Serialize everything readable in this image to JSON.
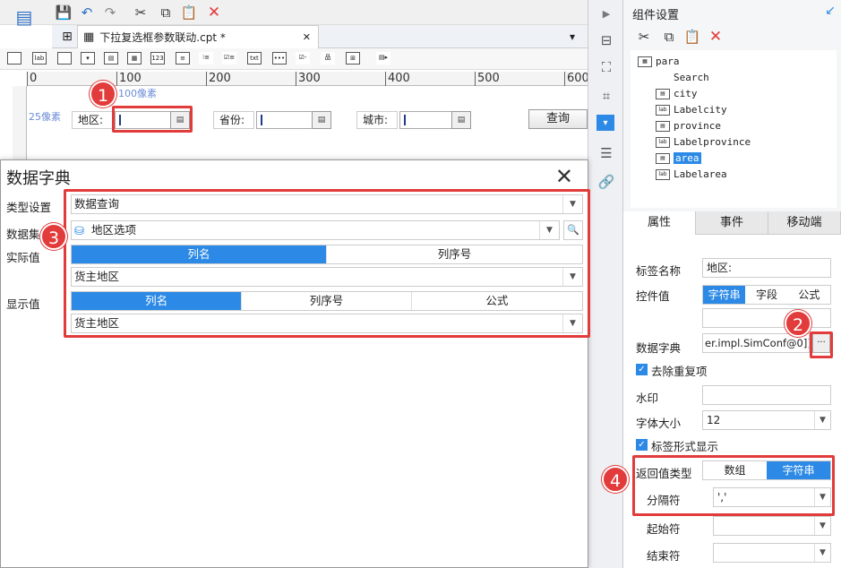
{
  "app": {
    "doc_tab_title": "下拉复选框参数联动.cpt *",
    "doc_tab_close": "✕"
  },
  "ruler": {
    "ticks": [
      "0",
      "100",
      "200",
      "300",
      "400",
      "500",
      "600"
    ],
    "hint_top": "100像素",
    "hint_left": "25像素"
  },
  "form": {
    "area_label": "地区:",
    "province_label": "省份:",
    "city_label": "城市:",
    "query_button": "查询"
  },
  "panel": {
    "title": "组件设置",
    "tree": [
      "para",
      "Search",
      "city",
      "Labelcity",
      "province",
      "Labelprovince",
      "area",
      "Labelarea"
    ],
    "tree_selected": "area",
    "tabs": [
      "属性",
      "事件",
      "移动端"
    ],
    "active_tab": "属性",
    "props": {
      "label_name_label": "标签名称",
      "label_name_value": "地区:",
      "control_value_label": "控件值",
      "control_value_options": [
        "字符串",
        "字段",
        "公式"
      ],
      "control_value_selected": "字符串",
      "dict_label": "数据字典",
      "dict_value": "er.impl.SimConf@0]]",
      "dict_button": "···",
      "dedupe_label": "去除重复项",
      "dedupe_checked": true,
      "watermark_label": "水印",
      "font_size_label": "字体大小",
      "font_size_value": "12",
      "tag_display_label": "标签形式显示",
      "tag_display_checked": true,
      "return_type_label": "返回值类型",
      "return_type_options": [
        "数组",
        "字符串"
      ],
      "return_type_selected": "字符串",
      "separator_label": "分隔符",
      "separator_value": "','",
      "start_label": "起始符",
      "end_label": "结束符"
    }
  },
  "dialog": {
    "title": "数据字典",
    "close": "✕",
    "type_label": "类型设置",
    "type_value": "数据查询",
    "dataset_label": "数据集",
    "dataset_value": "地区选项",
    "actual_label": "实际值",
    "actual_tabs": [
      "列名",
      "列序号"
    ],
    "actual_selected": "列名",
    "actual_value": "货主地区",
    "display_label": "显示值",
    "display_tabs": [
      "列名",
      "列序号",
      "公式"
    ],
    "display_selected": "列名",
    "display_value": "货主地区"
  },
  "callouts": [
    "1",
    "2",
    "3",
    "4"
  ],
  "colors": {
    "accent": "#2c8ae6",
    "callout": "#e23b3b"
  }
}
